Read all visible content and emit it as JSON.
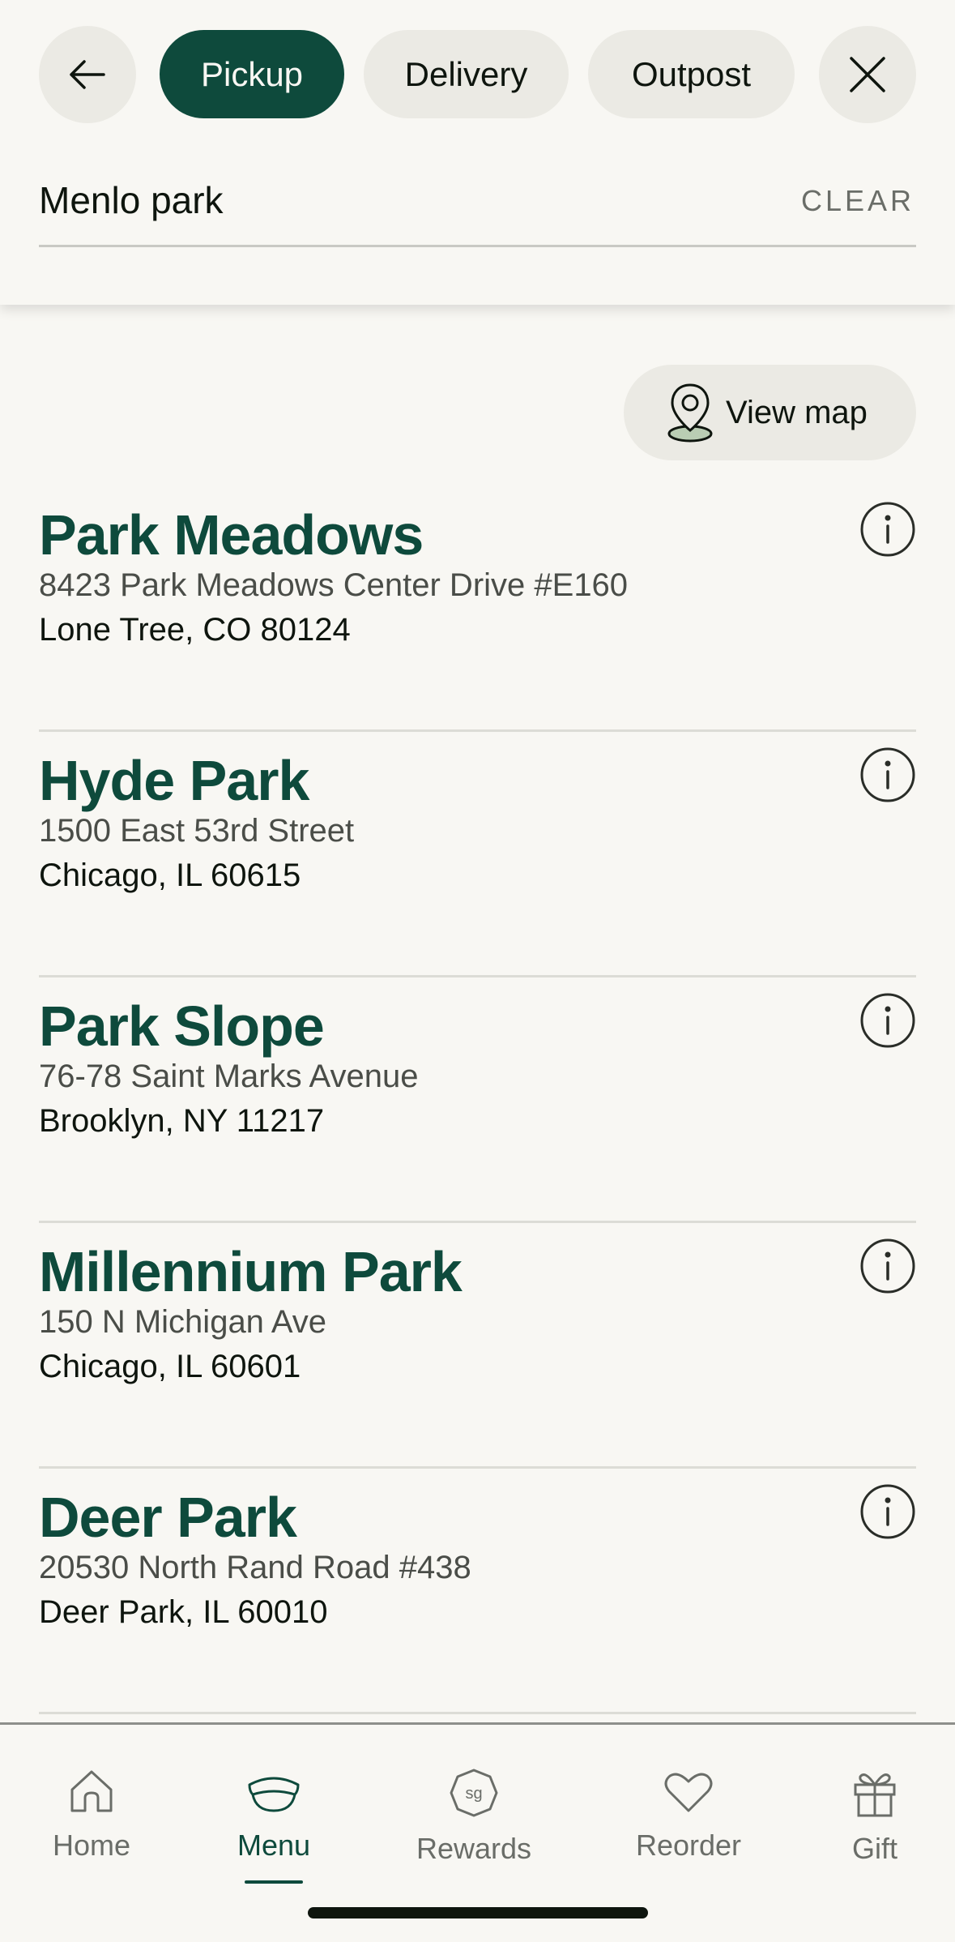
{
  "header": {
    "back_icon": "arrow-left-icon",
    "close_icon": "close-icon",
    "tabs": [
      {
        "label": "Pickup",
        "active": true
      },
      {
        "label": "Delivery",
        "active": false
      },
      {
        "label": "Outpost",
        "active": false
      }
    ],
    "search": {
      "value": "Menlo park",
      "clear_label": "CLEAR"
    }
  },
  "view_map": {
    "label": "View map",
    "icon": "map-pin-icon"
  },
  "stores": [
    {
      "name": "Park Meadows",
      "address1": "8423 Park Meadows Center Drive #E160",
      "address2": "Lone Tree, CO 80124"
    },
    {
      "name": "Hyde Park",
      "address1": "1500 East 53rd Street",
      "address2": "Chicago, IL 60615"
    },
    {
      "name": "Park Slope",
      "address1": "76-78 Saint Marks Avenue",
      "address2": "Brooklyn, NY 11217"
    },
    {
      "name": "Millennium Park",
      "address1": "150 N Michigan Ave",
      "address2": "Chicago, IL 60601"
    },
    {
      "name": "Deer Park",
      "address1": "20530 North Rand Road #438",
      "address2": "Deer Park, IL 60010"
    }
  ],
  "tabbar": {
    "items": [
      {
        "label": "Home",
        "icon": "home-icon"
      },
      {
        "label": "Menu",
        "icon": "bowl-icon",
        "active": true
      },
      {
        "label": "Rewards",
        "icon": "sg-badge-icon"
      },
      {
        "label": "Reorder",
        "icon": "heart-icon"
      },
      {
        "label": "Gift",
        "icon": "gift-icon"
      }
    ]
  },
  "colors": {
    "brand": "#0e4a3c",
    "background": "#f8f7f3",
    "chip": "#ebeae4"
  }
}
